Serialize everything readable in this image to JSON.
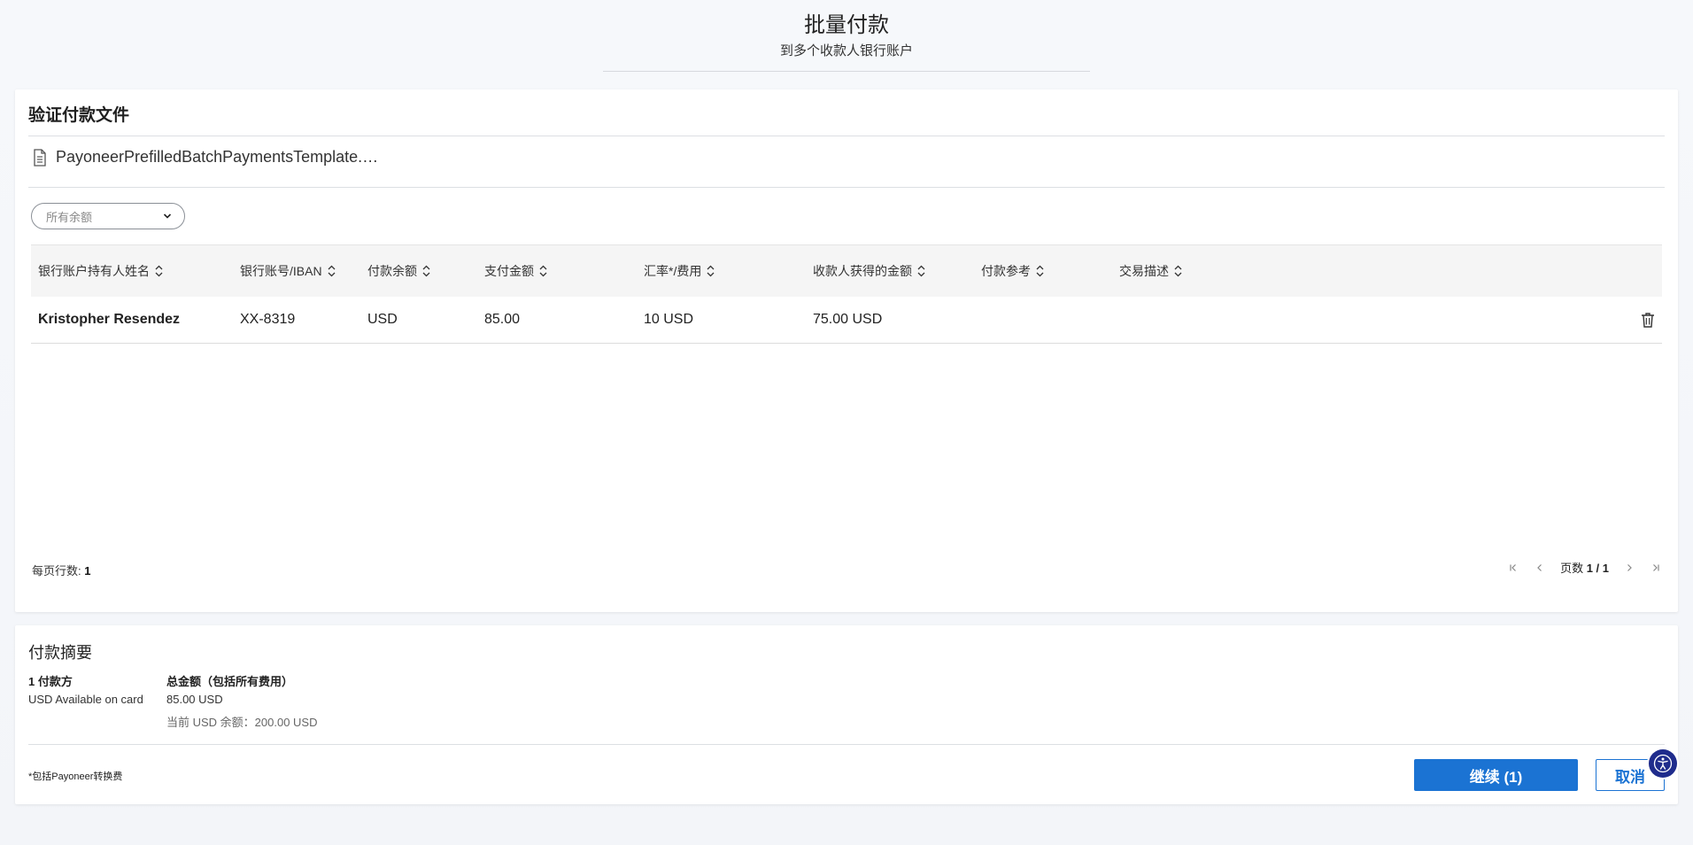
{
  "header": {
    "title": "批量付款",
    "subtitle": "到多个收款人银行账户"
  },
  "validate": {
    "title": "验证付款文件",
    "file_name": "PayoneerPrefilledBatchPaymentsTemplate.…",
    "filter": {
      "placeholder": "所有余额"
    },
    "columns": [
      "银行账户持有人姓名",
      "银行账号/IBAN",
      "付款余额",
      "支付金额",
      "汇率*/费用",
      "收款人获得的金额",
      "付款参考",
      "交易描述"
    ],
    "rows": [
      {
        "holder": "Kristopher Resendez",
        "account": "XX-8319",
        "balance": "USD",
        "amount": "85.00",
        "rate_fee": "10 USD",
        "recipient_gets": "75.00 USD",
        "reference": "",
        "description": ""
      }
    ],
    "rows_per_page_label": "每页行数: ",
    "rows_per_page_value": "1",
    "page_label": "页数 ",
    "page_value": "1 / 1"
  },
  "summary": {
    "title": "付款摘要",
    "payers_head": "1 付款方",
    "payer_source": "USD Available on card",
    "total_head": "总金额（包括所有费用）",
    "total_value": "85.00 USD",
    "current_balance": "当前 USD 余额：200.00 USD",
    "footnote": "*包括Payoneer转换费",
    "continue_label": "继续 (1)",
    "cancel_label": "取消"
  },
  "colors": {
    "accent": "#1b73d3",
    "a11y_badge": "#1f2c8c"
  },
  "icons": [
    "file-icon",
    "chevron-down-icon",
    "sort-icon",
    "trash-icon",
    "first-page-icon",
    "prev-page-icon",
    "next-page-icon",
    "last-page-icon",
    "accessibility-icon"
  ]
}
